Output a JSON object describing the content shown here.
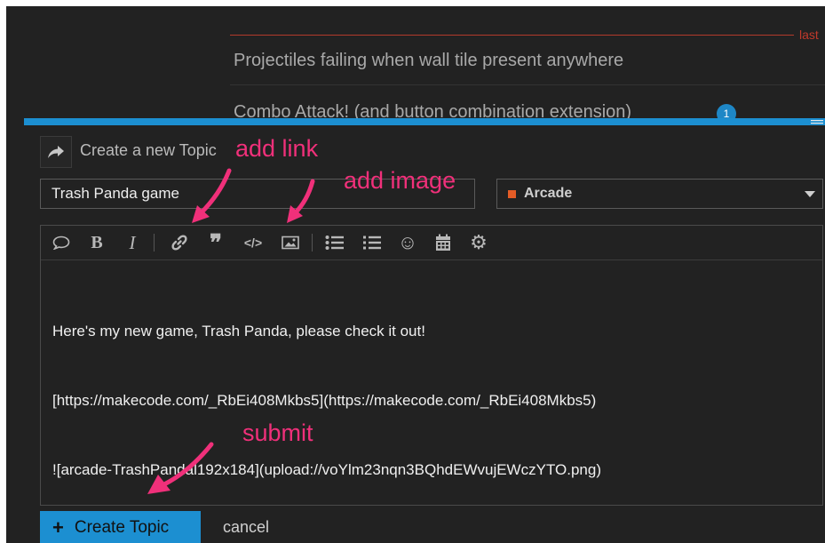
{
  "background": {
    "last_label": "last",
    "topics": [
      {
        "title": "Projectiles failing when wall tile present anywhere"
      },
      {
        "title": "Combo Attack! (and button combination extension)",
        "badge": "1"
      }
    ]
  },
  "composer": {
    "title": "Create a new Topic",
    "topic_title_value": "Trash Panda game",
    "category": {
      "label": "Arcade",
      "color": "#e45c26"
    },
    "toolbar": [
      {
        "name": "quote-bubble-icon"
      },
      {
        "name": "bold-icon",
        "glyph": "B"
      },
      {
        "name": "italic-icon",
        "glyph": "I"
      },
      {
        "name": "link-icon"
      },
      {
        "name": "blockquote-icon",
        "glyph": "❞"
      },
      {
        "name": "code-icon",
        "glyph": "</>"
      },
      {
        "name": "image-icon"
      },
      {
        "name": "bullet-list-icon"
      },
      {
        "name": "numbered-list-icon"
      },
      {
        "name": "emoji-icon",
        "glyph": "☺"
      },
      {
        "name": "calendar-icon"
      },
      {
        "name": "gear-icon",
        "glyph": "⚙"
      }
    ],
    "body_lines": [
      "Here's my new game, Trash Panda, please check it out!",
      "[https://makecode.com/_RbEi408Mkbs5](https://makecode.com/_RbEi408Mkbs5)",
      "![arcade-TrashPandal192x184](upload://voYlm23nqn3BQhdEWvujEWczYTO.png)"
    ],
    "create_label": "Create Topic",
    "cancel_label": "cancel"
  },
  "annotations": {
    "add_link": "add link",
    "add_image": "add image",
    "submit": "submit",
    "color": "#f0307a"
  },
  "colors": {
    "accent": "#1c8fd1",
    "background": "#222222"
  }
}
